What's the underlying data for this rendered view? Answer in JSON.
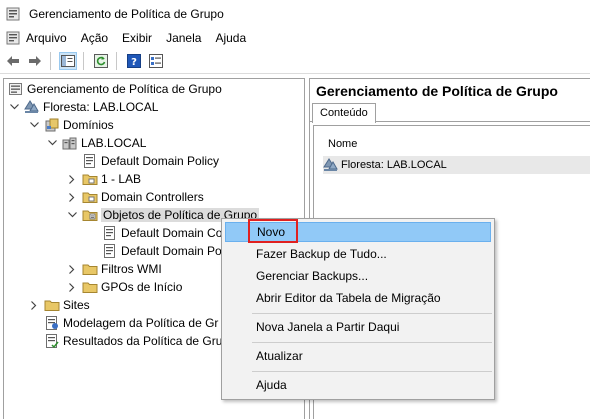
{
  "window": {
    "title": "Gerenciamento de Política de Grupo",
    "icon": "gpmc-app-icon"
  },
  "menu": [
    "Arquivo",
    "Ação",
    "Exibir",
    "Janela",
    "Ajuda"
  ],
  "toolbar": [
    "back-arrow-icon",
    "forward-arrow-icon",
    "show-hide-tree-icon",
    "refresh-icon",
    "help-icon",
    "properties-icon"
  ],
  "tree": {
    "root": "Gerenciamento de Política de Grupo",
    "forest": "Floresta: LAB.LOCAL",
    "domains": "Domínios",
    "domain": "LAB.LOCAL",
    "default_policy": "Default Domain Policy",
    "ou_lab": "1 - LAB",
    "domain_controllers": "Domain Controllers",
    "gpo_objects": "Objetos de Política de Grupo",
    "gpo1": "Default Domain Co",
    "gpo2": "Default Domain Po",
    "wmi_filters": "Filtros WMI",
    "starter_gpos": "GPOs de Início",
    "sites": "Sites",
    "modeling": "Modelagem da Política de Gr",
    "results": "Resultados da Política de Gru"
  },
  "right": {
    "title": "Gerenciamento de Política de Grupo",
    "tab": "Conteúdo",
    "column": "Nome",
    "row": "Floresta: LAB.LOCAL"
  },
  "context_menu": {
    "items": [
      "Novo",
      "Fazer Backup de Tudo...",
      "Gerenciar Backups...",
      "Abrir Editor da Tabela de Migração",
      "Nova Janela a Partir Daqui",
      "Atualizar",
      "Ajuda"
    ],
    "active": "Novo"
  },
  "colors": {
    "highlight": "#91c9f7",
    "annotation": "#e02020",
    "menu_bg": "#f2f2f2"
  }
}
